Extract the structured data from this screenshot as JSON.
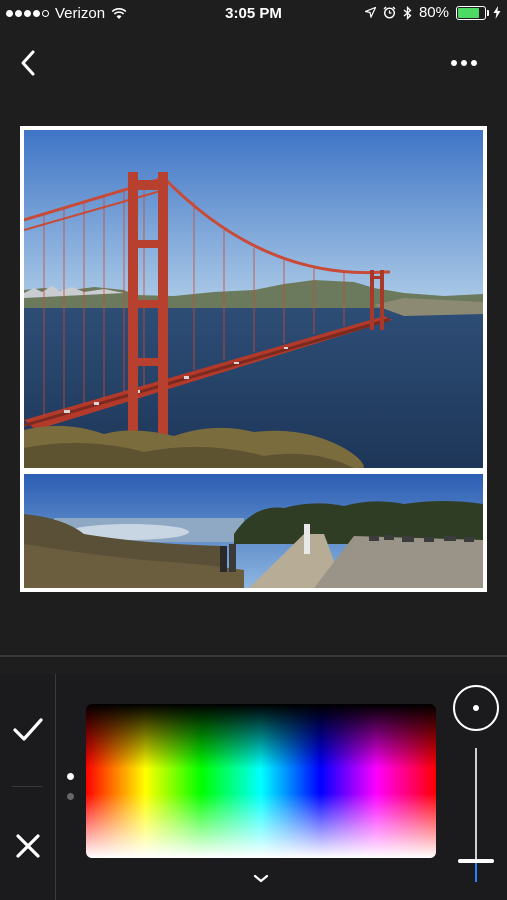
{
  "status_bar": {
    "carrier": "Verizon",
    "time": "3:05 PM",
    "battery_percent": "80%",
    "battery_level": 0.8,
    "signal_bars": 4
  },
  "header": {
    "back_icon": "chevron-left-icon",
    "more_icon": "ellipsis-icon"
  },
  "collage": {
    "photos": [
      {
        "subject": "Golden Gate Bridge"
      },
      {
        "subject": "Coastal panorama"
      }
    ]
  },
  "tools": {
    "confirm_icon": "checkmark-icon",
    "cancel_icon": "close-icon",
    "page_indicator": {
      "count": 2,
      "active": 0
    },
    "color_picker": {
      "type": "spectrum"
    },
    "brush_size": {
      "value": 0.1
    },
    "collapse_icon": "chevron-down-icon"
  },
  "colors": {
    "background": "#1e1e1f",
    "panel": "#1b1b1d",
    "divider": "#3a3a3c",
    "battery_fill": "#4cd964",
    "slider_fill": "#2a7fff"
  }
}
